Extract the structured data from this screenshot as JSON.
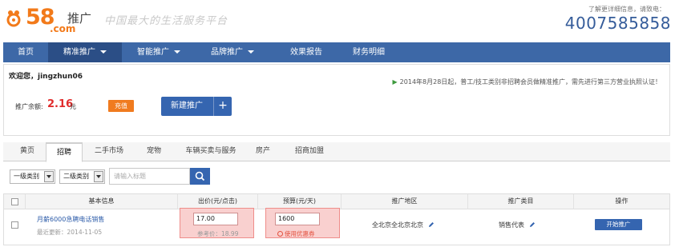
{
  "brand": {
    "logo_number": "58",
    "logo_domain": ".com",
    "logo_product": "推广",
    "slogan": "中国最大的生活服务平台",
    "contact_label": "了解更详细信息，请致电：",
    "contact_phone": "4007585858",
    "accent_color": "#f27a1a",
    "nav_color": "#3d68a7"
  },
  "nav": {
    "items": [
      {
        "label": "首页",
        "dropdown": false
      },
      {
        "label": "精准推广",
        "dropdown": true,
        "active": true
      },
      {
        "label": "智能推广",
        "dropdown": true
      },
      {
        "label": "品牌推广",
        "dropdown": true
      },
      {
        "label": "效果报告",
        "dropdown": false
      },
      {
        "label": "财务明细",
        "dropdown": false
      }
    ]
  },
  "account": {
    "welcome": "欢迎您，jingzhun06",
    "notice": "2014年8月28日起，普工/技工类别非招聘会员做精准推广，需先进行第三方营业执照认证！",
    "balance_label": "推广余额:",
    "balance_value": "2.16",
    "balance_unit": "元",
    "recharge_label": "充值",
    "new_campaign_label": "新建推广",
    "new_campaign_plus": "+"
  },
  "tabs": {
    "items": [
      "黄页",
      "招聘",
      "二手市场",
      "宠物",
      "车辆买卖与服务",
      "房产",
      "招商加盟"
    ],
    "active_index": 1
  },
  "filter": {
    "category1": "一级类别",
    "category2": "二级类别",
    "search_placeholder": "请输入标题"
  },
  "table": {
    "headers": {
      "basic_info": "基本信息",
      "bid": "出价(元/点击)",
      "budget": "预算(元/天)",
      "region": "推广地区",
      "category": "推广类目",
      "action": "操作"
    },
    "rows": [
      {
        "title": "月薪6000急聘电话销售",
        "updated": "最近更新：2014-11-05",
        "bid": "17.00",
        "ref_price": "参考价：18.99",
        "budget": "1600",
        "coupon": "使用优惠券",
        "region": "全北京全北京北京",
        "category": "销售代表",
        "action": "开始推广"
      }
    ]
  }
}
